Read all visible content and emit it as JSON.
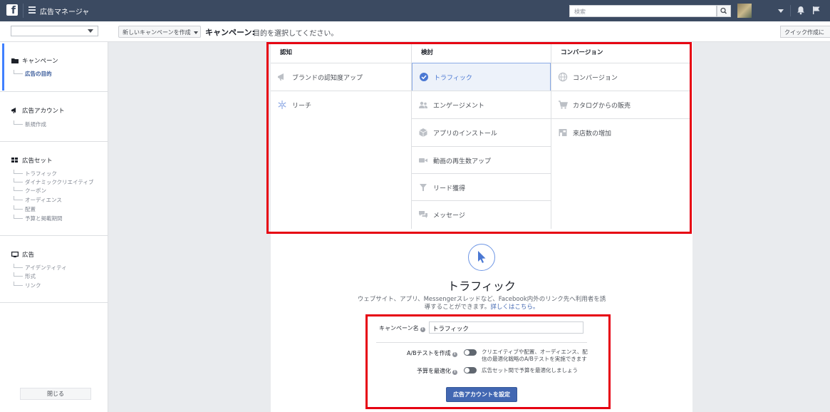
{
  "topbar": {
    "logo": "f",
    "app_title": "広告マネージャ",
    "search_placeholder": "検索"
  },
  "subheader": {
    "new_campaign_label": "新しいキャンペーンを作成",
    "breadcrumb_title": "キャンペーン:",
    "breadcrumb_desc": "目的を選択してください。",
    "quick_create_label": "クイック作成に"
  },
  "sidebar": {
    "campaign": {
      "label": "キャンペーン",
      "items": [
        "広告の目的"
      ]
    },
    "ad_account": {
      "label": "広告アカウント",
      "items": [
        "新規作成"
      ]
    },
    "ad_set": {
      "label": "広告セット",
      "items": [
        "トラフィック",
        "ダイナミッククリエイティブ",
        "クーポン",
        "オーディエンス",
        "配置",
        "予算と掲載期間"
      ]
    },
    "ad": {
      "label": "広告",
      "items": [
        "アイデンティティ",
        "形式",
        "リンク"
      ]
    },
    "close_label": "閉じる"
  },
  "objectives": {
    "awareness": {
      "header": "認知",
      "items": [
        "ブランドの認知度アップ",
        "リーチ"
      ]
    },
    "consideration": {
      "header": "検討",
      "items": [
        "トラフィック",
        "エンゲージメント",
        "アプリのインストール",
        "動画の再生数アップ",
        "リード獲得",
        "メッセージ"
      ]
    },
    "conversion": {
      "header": "コンバージョン",
      "items": [
        "コンバージョン",
        "カタログからの販売",
        "来店数の増加"
      ]
    },
    "selected": "トラフィック"
  },
  "detail": {
    "title": "トラフィック",
    "description": "ウェブサイト、アプリ、Messengerスレッドなど、Facebook内外のリンク先へ利用者を誘導することができます。",
    "learn_more": "詳しくはこちら。",
    "campaign_name_label": "キャンペーン名",
    "campaign_name_value": "トラフィック",
    "ab_test_label": "A/Bテストを作成",
    "ab_test_desc": "クリエイティブや配置、オーディエンス、配信の最適化戦略のA/Bテストを実施できます",
    "budget_opt_label": "予算を最適化",
    "budget_opt_desc": "広告セット間で予算を最適化しましょう",
    "set_account_button": "広告アカウントを設定"
  },
  "colors": {
    "topbar": "#3b4a61",
    "accent": "#4267b2",
    "highlight": "#e60012",
    "selected_bg": "#edf2fa"
  }
}
